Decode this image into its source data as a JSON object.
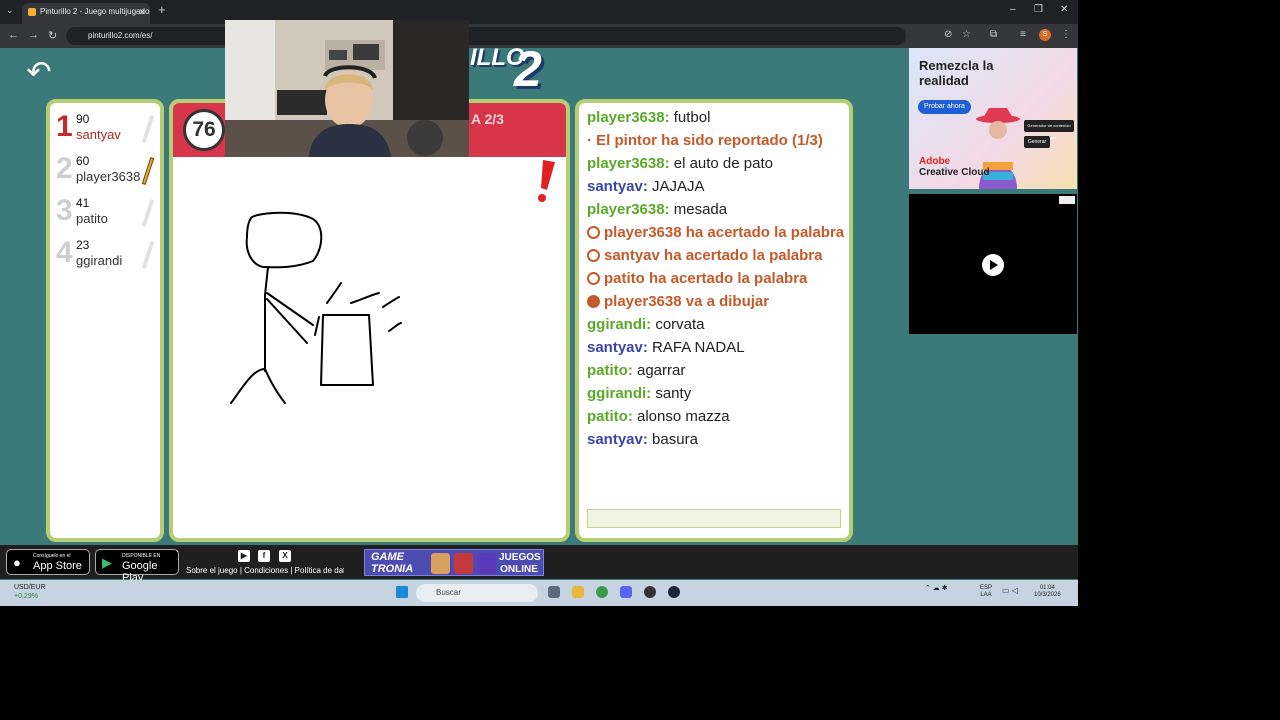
{
  "browser": {
    "tab_title": "Pinturillo 2 - Juego multijugador",
    "url": "pinturillo2.com/es/",
    "profile_initial": "S"
  },
  "game": {
    "logo_text": "ILLO",
    "logo_number": "2",
    "timer": "76",
    "round": "A 2/3",
    "players": [
      {
        "rank": "1",
        "score": "90",
        "name": "santyav"
      },
      {
        "rank": "2",
        "score": "60",
        "name": "player3638"
      },
      {
        "rank": "3",
        "score": "41",
        "name": "patito"
      },
      {
        "rank": "4",
        "score": "23",
        "name": "ggirandi"
      }
    ],
    "chat": [
      {
        "type": "user",
        "who": "player3638:",
        "text": " futbol",
        "color": "green"
      },
      {
        "type": "sys",
        "prefix": "· ",
        "text": "El pintor ha sido reportado (1/3)"
      },
      {
        "type": "user",
        "who": "player3638:",
        "text": " el auto de pato",
        "color": "green"
      },
      {
        "type": "user",
        "who": "santyav:",
        "text": " JAJAJA",
        "color": "blue"
      },
      {
        "type": "user",
        "who": "player3638:",
        "text": " mesada",
        "color": "green"
      },
      {
        "type": "sys-icon",
        "text": "player3638 ha acertado la palabra",
        "icon": "check-circle-icon"
      },
      {
        "type": "sys-icon",
        "text": "santyav ha acertado la palabra",
        "icon": "check-circle-icon"
      },
      {
        "type": "sys-icon",
        "text": "patito ha acertado la palabra",
        "icon": "check-circle-icon"
      },
      {
        "type": "sys-icon",
        "text": "player3638 va a dibujar",
        "icon": "pencil-circle-icon"
      },
      {
        "type": "user",
        "who": "ggirandi:",
        "text": " corvata",
        "color": "green"
      },
      {
        "type": "user",
        "who": "santyav:",
        "text": " RAFA NADAL",
        "color": "blue"
      },
      {
        "type": "user",
        "who": "patito:",
        "text": " agarrar",
        "color": "green"
      },
      {
        "type": "user",
        "who": "ggirandi:",
        "text": " santy",
        "color": "green"
      },
      {
        "type": "user",
        "who": "patito:",
        "text": " alonso mazza",
        "color": "green"
      },
      {
        "type": "user",
        "who": "santyav:",
        "text": " basura",
        "color": "blue"
      }
    ]
  },
  "ads": {
    "ad1_headline": "Remezcla la realidad",
    "ad1_button": "Probar ahora",
    "ad1_brand1": "Adobe",
    "ad1_brand2": "Creative Cloud",
    "ad1_chip1": "Generador de contenido ilimitado",
    "ad1_chip2": "Generar"
  },
  "footer": {
    "appstore_small": "Consíguelo en el",
    "appstore_big": "App Store",
    "gplay_small": "DISPONIBLE EN",
    "gplay_big": "Google Play",
    "links": "Sobre el juego | Condiciones | Política de dat",
    "gametronia": "GAME TRONIA",
    "juegos_online": "JUEGOS ONLINE"
  },
  "taskbar": {
    "weather_title": "USD/EUR",
    "weather_sub": "+0,29%",
    "search": "Buscar",
    "lang1": "ESP",
    "lang2": "LAA",
    "time": "01:04",
    "date": "10/3/2026"
  },
  "colors": {
    "chat_green": "#5aaa28",
    "chat_blue": "#3a47a8",
    "system": "#c45a2a",
    "border": "#b7cd74",
    "bg": "#3b7a78"
  }
}
